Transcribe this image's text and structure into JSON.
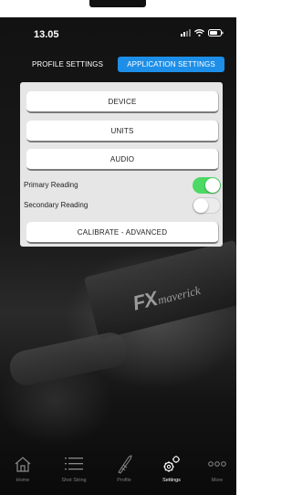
{
  "status_bar": {
    "time": "13.05"
  },
  "tabs": [
    {
      "label": "PROFILE SETTINGS",
      "active": false
    },
    {
      "label": "APPLICATION SETTINGS",
      "active": true
    }
  ],
  "panel": {
    "buttons": {
      "device": "DEVICE",
      "units": "UNITS",
      "audio": "AUDIO",
      "calibrate": "CALIBRATE - ADVANCED"
    },
    "toggles": [
      {
        "label": "Primary Reading",
        "on": true
      },
      {
        "label": "Secondary Reading",
        "on": false
      }
    ]
  },
  "background_brand": {
    "fx": "FX",
    "name": "maverick"
  },
  "bottom_nav": [
    {
      "label": "Home",
      "icon": "home-icon",
      "active": false
    },
    {
      "label": "Shot String",
      "icon": "list-icon",
      "active": false
    },
    {
      "label": "Profile",
      "icon": "bullet-icon",
      "active": false
    },
    {
      "label": "Settings",
      "icon": "gears-icon",
      "active": true
    },
    {
      "label": "More",
      "icon": "more-dots-icon",
      "active": false
    }
  ],
  "colors": {
    "tab_active": "#1e8fe8",
    "toggle_on": "#4cd964",
    "panel_bg": "#e6e6e6"
  }
}
